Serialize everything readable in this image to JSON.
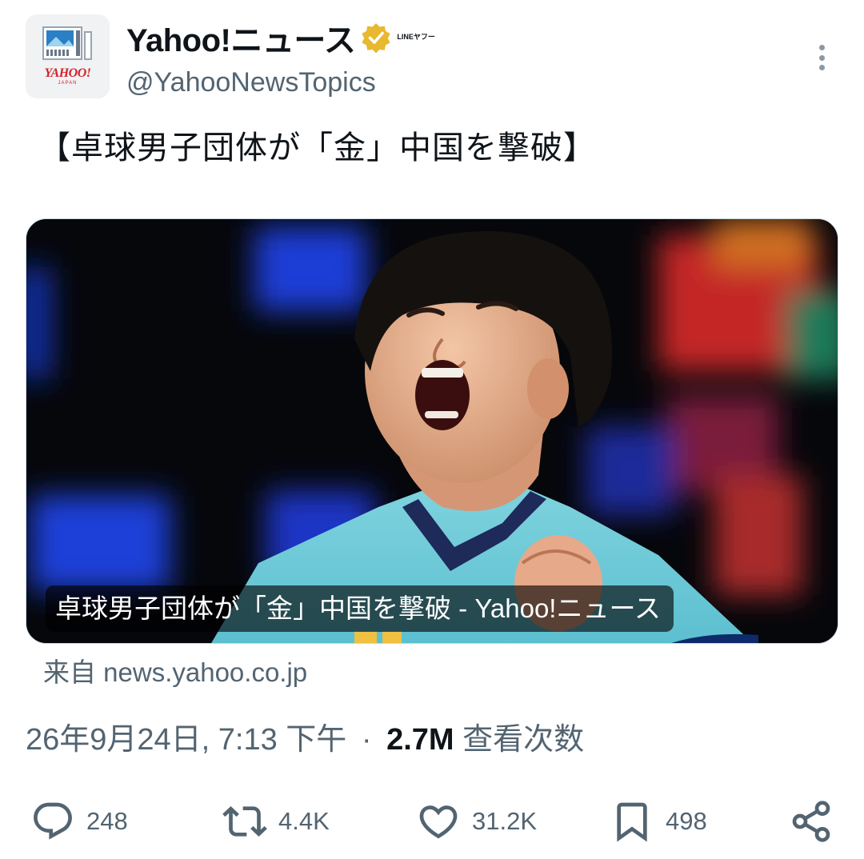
{
  "account": {
    "display_name": "Yahoo!ニュース",
    "handle": "@YahooNewsTopics",
    "affiliation": "LINEヤフー",
    "avatar_logo": "YAHOO!",
    "avatar_logo_sub": "JAPAN"
  },
  "post": {
    "text": "【卓球男子団体が「金」中国を撃破】"
  },
  "card": {
    "caption": "卓球男子団体が「金」中国を撃破 - Yahoo!ニュース",
    "source": "来自 news.yahoo.co.jp"
  },
  "meta": {
    "timestamp": "26年9月24日, 7:13 下午",
    "separator": "·",
    "views_count": "2.7M",
    "views_label": "查看次数"
  },
  "actions": {
    "replies": "248",
    "reposts": "4.4K",
    "likes": "31.2K",
    "bookmarks": "498"
  },
  "icons": {
    "verified": "verified-badge-icon",
    "more": "more-options-icon",
    "reply": "reply-icon",
    "repost": "repost-icon",
    "like": "heart-icon",
    "bookmark": "bookmark-icon",
    "share": "share-icon"
  },
  "colors": {
    "verified_gold": "#e8b82f",
    "text_primary": "#0f1419",
    "text_secondary": "#536471",
    "yahoo_red": "#d4232b"
  }
}
